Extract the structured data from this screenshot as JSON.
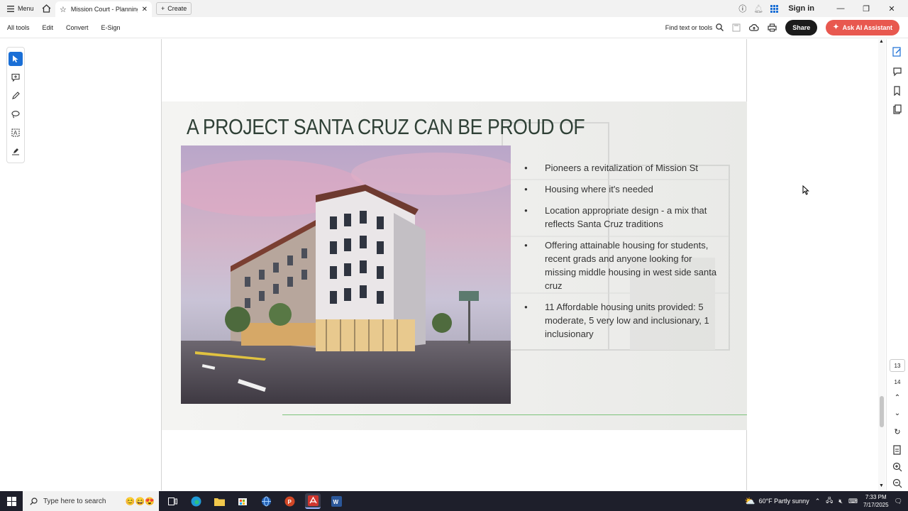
{
  "titlebar": {
    "menu_label": "Menu",
    "tab_title": "Mission Court - Planning...",
    "create_label": "Create",
    "signin_label": "Sign in"
  },
  "toolbar": {
    "all_tools": "All tools",
    "edit": "Edit",
    "convert": "Convert",
    "esign": "E-Sign",
    "find_label": "Find text or tools",
    "share_label": "Share",
    "ai_label": "Ask AI Assistant"
  },
  "slide": {
    "title": "A PROJECT SANTA CRUZ CAN BE PROUD OF",
    "bullets": [
      "Pioneers a revitalization of Mission St",
      "Housing where it's needed",
      "Location appropriate design - a mix that reflects Santa Cruz traditions",
      "Offering attainable housing for students, recent grads and anyone looking for missing middle housing in west side santa cruz",
      "11 Affordable housing units provided:   5 moderate, 5 very low and inclusionary, 1 inclusionary"
    ]
  },
  "pages": {
    "current": "13",
    "next": "14"
  },
  "taskbar": {
    "search_placeholder": "Type here to search",
    "weather": "60°F  Partly sunny",
    "time": "7:33 PM",
    "date": "7/17/2025"
  },
  "colors": {
    "accent_blue": "#1a6fd6",
    "ai_button": "#e8584f",
    "slide_title": "#2f4036",
    "green_rule": "#7cc37a"
  }
}
